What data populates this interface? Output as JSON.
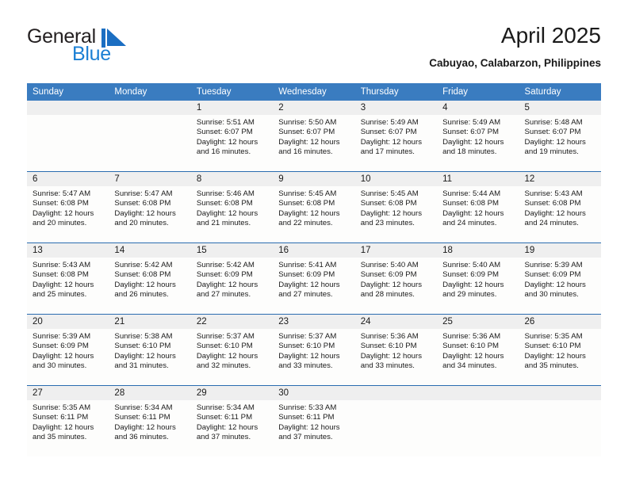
{
  "brand": {
    "name_part1": "General",
    "name_part2": "Blue",
    "accent_color": "#1b7fd4",
    "header_color": "#3a7cc0"
  },
  "header": {
    "title": "April 2025",
    "subtitle": "Cabuyao, Calabarzon, Philippines"
  },
  "calendar": {
    "weekday_headers": [
      "Sunday",
      "Monday",
      "Tuesday",
      "Wednesday",
      "Thursday",
      "Friday",
      "Saturday"
    ],
    "weeks": [
      [
        {
          "day": "",
          "details": ""
        },
        {
          "day": "",
          "details": ""
        },
        {
          "day": "1",
          "details": "Sunrise: 5:51 AM\nSunset: 6:07 PM\nDaylight: 12 hours\nand 16 minutes."
        },
        {
          "day": "2",
          "details": "Sunrise: 5:50 AM\nSunset: 6:07 PM\nDaylight: 12 hours\nand 16 minutes."
        },
        {
          "day": "3",
          "details": "Sunrise: 5:49 AM\nSunset: 6:07 PM\nDaylight: 12 hours\nand 17 minutes."
        },
        {
          "day": "4",
          "details": "Sunrise: 5:49 AM\nSunset: 6:07 PM\nDaylight: 12 hours\nand 18 minutes."
        },
        {
          "day": "5",
          "details": "Sunrise: 5:48 AM\nSunset: 6:07 PM\nDaylight: 12 hours\nand 19 minutes."
        }
      ],
      [
        {
          "day": "6",
          "details": "Sunrise: 5:47 AM\nSunset: 6:08 PM\nDaylight: 12 hours\nand 20 minutes."
        },
        {
          "day": "7",
          "details": "Sunrise: 5:47 AM\nSunset: 6:08 PM\nDaylight: 12 hours\nand 20 minutes."
        },
        {
          "day": "8",
          "details": "Sunrise: 5:46 AM\nSunset: 6:08 PM\nDaylight: 12 hours\nand 21 minutes."
        },
        {
          "day": "9",
          "details": "Sunrise: 5:45 AM\nSunset: 6:08 PM\nDaylight: 12 hours\nand 22 minutes."
        },
        {
          "day": "10",
          "details": "Sunrise: 5:45 AM\nSunset: 6:08 PM\nDaylight: 12 hours\nand 23 minutes."
        },
        {
          "day": "11",
          "details": "Sunrise: 5:44 AM\nSunset: 6:08 PM\nDaylight: 12 hours\nand 24 minutes."
        },
        {
          "day": "12",
          "details": "Sunrise: 5:43 AM\nSunset: 6:08 PM\nDaylight: 12 hours\nand 24 minutes."
        }
      ],
      [
        {
          "day": "13",
          "details": "Sunrise: 5:43 AM\nSunset: 6:08 PM\nDaylight: 12 hours\nand 25 minutes."
        },
        {
          "day": "14",
          "details": "Sunrise: 5:42 AM\nSunset: 6:08 PM\nDaylight: 12 hours\nand 26 minutes."
        },
        {
          "day": "15",
          "details": "Sunrise: 5:42 AM\nSunset: 6:09 PM\nDaylight: 12 hours\nand 27 minutes."
        },
        {
          "day": "16",
          "details": "Sunrise: 5:41 AM\nSunset: 6:09 PM\nDaylight: 12 hours\nand 27 minutes."
        },
        {
          "day": "17",
          "details": "Sunrise: 5:40 AM\nSunset: 6:09 PM\nDaylight: 12 hours\nand 28 minutes."
        },
        {
          "day": "18",
          "details": "Sunrise: 5:40 AM\nSunset: 6:09 PM\nDaylight: 12 hours\nand 29 minutes."
        },
        {
          "day": "19",
          "details": "Sunrise: 5:39 AM\nSunset: 6:09 PM\nDaylight: 12 hours\nand 30 minutes."
        }
      ],
      [
        {
          "day": "20",
          "details": "Sunrise: 5:39 AM\nSunset: 6:09 PM\nDaylight: 12 hours\nand 30 minutes."
        },
        {
          "day": "21",
          "details": "Sunrise: 5:38 AM\nSunset: 6:10 PM\nDaylight: 12 hours\nand 31 minutes."
        },
        {
          "day": "22",
          "details": "Sunrise: 5:37 AM\nSunset: 6:10 PM\nDaylight: 12 hours\nand 32 minutes."
        },
        {
          "day": "23",
          "details": "Sunrise: 5:37 AM\nSunset: 6:10 PM\nDaylight: 12 hours\nand 33 minutes."
        },
        {
          "day": "24",
          "details": "Sunrise: 5:36 AM\nSunset: 6:10 PM\nDaylight: 12 hours\nand 33 minutes."
        },
        {
          "day": "25",
          "details": "Sunrise: 5:36 AM\nSunset: 6:10 PM\nDaylight: 12 hours\nand 34 minutes."
        },
        {
          "day": "26",
          "details": "Sunrise: 5:35 AM\nSunset: 6:10 PM\nDaylight: 12 hours\nand 35 minutes."
        }
      ],
      [
        {
          "day": "27",
          "details": "Sunrise: 5:35 AM\nSunset: 6:11 PM\nDaylight: 12 hours\nand 35 minutes."
        },
        {
          "day": "28",
          "details": "Sunrise: 5:34 AM\nSunset: 6:11 PM\nDaylight: 12 hours\nand 36 minutes."
        },
        {
          "day": "29",
          "details": "Sunrise: 5:34 AM\nSunset: 6:11 PM\nDaylight: 12 hours\nand 37 minutes."
        },
        {
          "day": "30",
          "details": "Sunrise: 5:33 AM\nSunset: 6:11 PM\nDaylight: 12 hours\nand 37 minutes."
        },
        {
          "day": "",
          "details": ""
        },
        {
          "day": "",
          "details": ""
        },
        {
          "day": "",
          "details": ""
        }
      ]
    ]
  }
}
